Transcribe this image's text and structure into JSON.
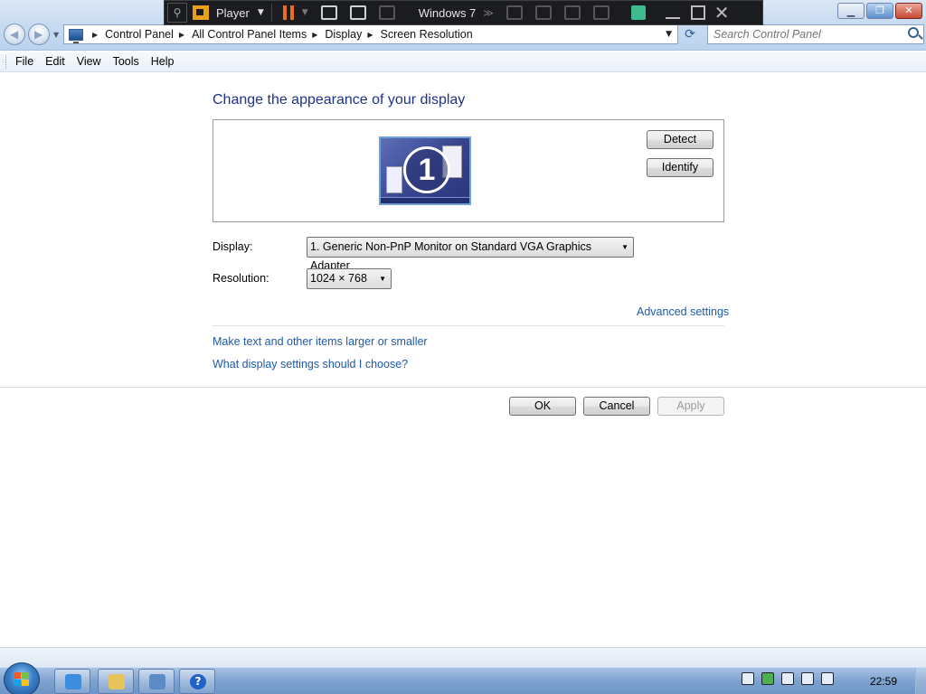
{
  "player": {
    "label": "Player",
    "vm_name": "Windows 7"
  },
  "address": {
    "breadcrumbs": [
      "Control Panel",
      "All Control Panel Items",
      "Display",
      "Screen Resolution"
    ],
    "search_placeholder": "Search Control Panel"
  },
  "menu": {
    "items": [
      "File",
      "Edit",
      "View",
      "Tools",
      "Help"
    ]
  },
  "main": {
    "heading": "Change the appearance of your display",
    "monitor_number": "1",
    "detect_label": "Detect",
    "identify_label": "Identify",
    "display_label": "Display:",
    "display_value": "1. Generic Non-PnP Monitor on Standard VGA Graphics Adapter",
    "resolution_label": "Resolution:",
    "resolution_value": "1024 × 768",
    "advanced_link": "Advanced settings",
    "text_size_link": "Make text and other items larger or smaller",
    "which_settings_link": "What display settings should I choose?",
    "ok_label": "OK",
    "cancel_label": "Cancel",
    "apply_label": "Apply"
  },
  "taskbar": {
    "apps": [
      "internet-explorer-icon",
      "windows-explorer-icon",
      "control-panel-icon",
      "help-icon"
    ],
    "clock": "22:59"
  },
  "colors": {
    "link": "#1e5aa8",
    "heading": "#1e3287",
    "player_accent": "#ee6d1d"
  }
}
